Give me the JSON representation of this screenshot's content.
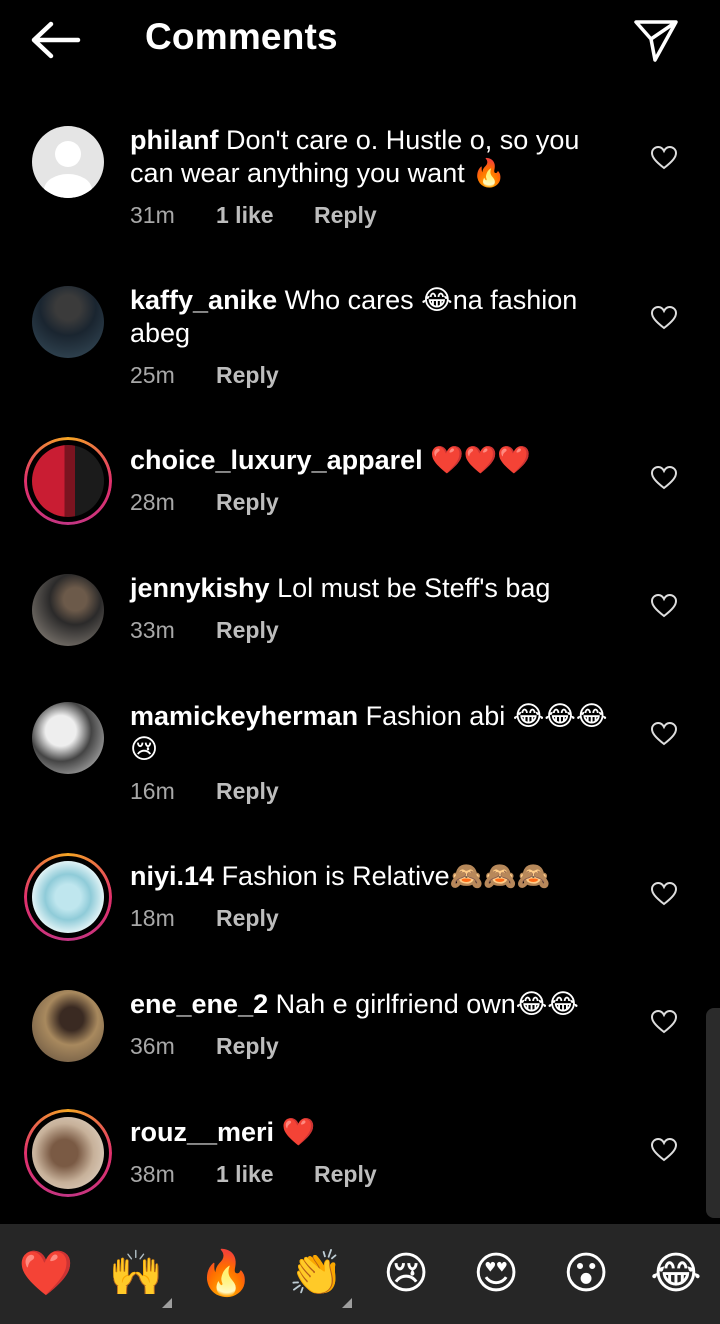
{
  "header": {
    "title": "Comments",
    "back_icon": "arrow-left-icon",
    "send_icon": "paper-plane-icon"
  },
  "comments": [
    {
      "username": "philanf",
      "text": "Don't care o. Hustle o, so you can wear anything you want 🔥",
      "time": "31m",
      "likes": "1 like",
      "reply": "Reply"
    },
    {
      "username": "kaffy_anike",
      "text": "Who cares 😂na fashion abeg",
      "time": "25m",
      "likes": "",
      "reply": "Reply"
    },
    {
      "username": "choice_luxury_apparel",
      "text": "❤️❤️❤️",
      "time": "28m",
      "likes": "",
      "reply": "Reply"
    },
    {
      "username": "jennykishy",
      "text": "Lol must be Steff's bag",
      "time": "33m",
      "likes": "",
      "reply": "Reply"
    },
    {
      "username": "mamickeyherman",
      "text": "Fashion abi 😂😂😂 😢",
      "time": "16m",
      "likes": "",
      "reply": "Reply"
    },
    {
      "username": "niyi.14",
      "text": "Fashion is Relative🙈🙈🙈",
      "time": "18m",
      "likes": "",
      "reply": "Reply"
    },
    {
      "username": "ene_ene_2",
      "text": "Nah e girlfriend own😂😂",
      "time": "36m",
      "likes": "",
      "reply": "Reply"
    },
    {
      "username": "rouz__meri",
      "text": "❤️",
      "time": "38m",
      "likes": "1 like",
      "reply": "Reply"
    }
  ],
  "emoji_bar": [
    "❤️",
    "🙌",
    "🔥",
    "👏",
    "😢",
    "😍",
    "😮",
    "😂"
  ],
  "colors": {
    "background": "#000000",
    "meta": "#a8a8a8",
    "emoji_bar": "#262626"
  }
}
